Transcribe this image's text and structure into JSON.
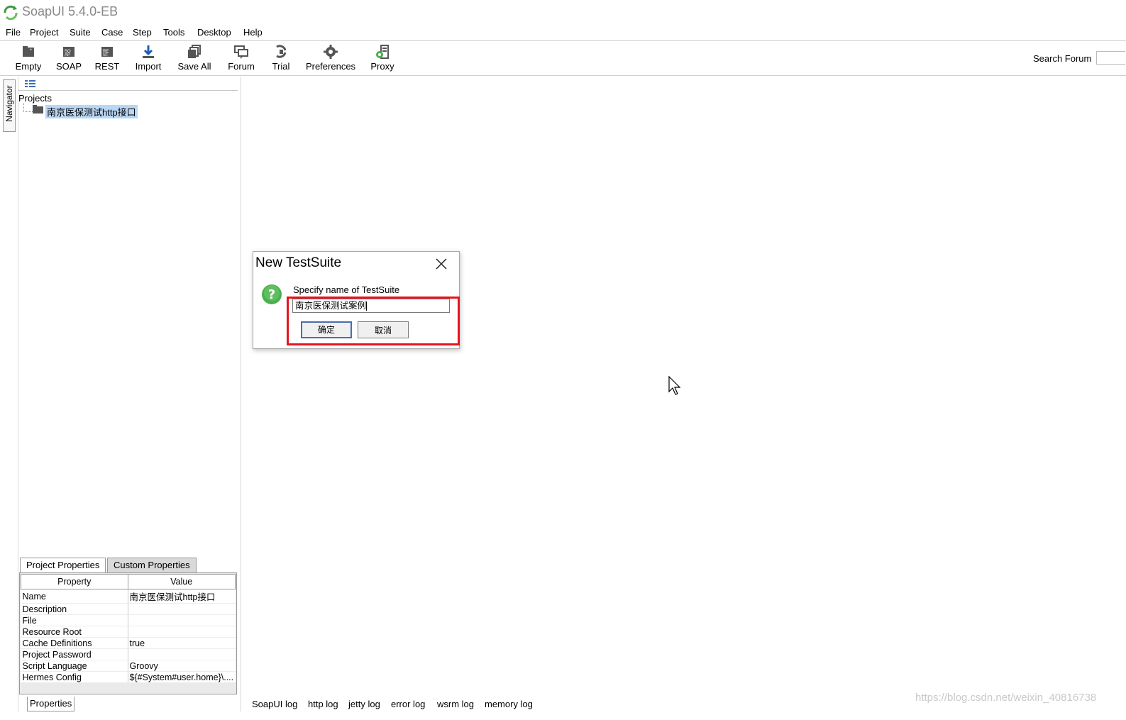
{
  "app": {
    "title": "SoapUI 5.4.0-EB"
  },
  "menu": [
    "File",
    "Project",
    "Suite",
    "Case",
    "Step",
    "Tools",
    "Desktop",
    "Help"
  ],
  "toolbar": {
    "buttons": [
      {
        "label": "Empty",
        "icon": "empty-project-icon"
      },
      {
        "label": "SOAP",
        "icon": "soap-project-icon"
      },
      {
        "label": "REST",
        "icon": "rest-project-icon"
      },
      {
        "label": "Import",
        "icon": "import-icon"
      },
      {
        "label": "Save All",
        "icon": "save-all-icon"
      },
      {
        "label": "Forum",
        "icon": "forum-icon"
      },
      {
        "label": "Trial",
        "icon": "trial-icon"
      },
      {
        "label": "Preferences",
        "icon": "gear-icon"
      },
      {
        "label": "Proxy",
        "icon": "proxy-icon"
      }
    ],
    "search_label": "Search Forum"
  },
  "navigator": {
    "tab_label": "Navigator",
    "root": "Projects",
    "project": "南京医保测试http接口"
  },
  "properties": {
    "tabs": [
      "Project Properties",
      "Custom Properties"
    ],
    "headers": [
      "Property",
      "Value"
    ],
    "rows": [
      [
        "Name",
        "南京医保测试http接口"
      ],
      [
        "Description",
        ""
      ],
      [
        "File",
        ""
      ],
      [
        "Resource Root",
        ""
      ],
      [
        "Cache Definitions",
        "true"
      ],
      [
        "Project Password",
        ""
      ],
      [
        "Script Language",
        "Groovy"
      ],
      [
        "Hermes Config",
        "${#System#user.home}\\...."
      ]
    ],
    "bottom_tab": "Properties"
  },
  "logs": [
    "SoapUI log",
    "http log",
    "jetty log",
    "error log",
    "wsrm log",
    "memory log"
  ],
  "dialog": {
    "title": "New TestSuite",
    "message": "Specify name of TestSuite",
    "input_value": "南京医保测试案例",
    "ok_label": "确定",
    "cancel_label": "取消"
  },
  "watermark": "https://blog.csdn.net/weixin_40816738",
  "colors": {
    "highlight": "#e8121b",
    "selection": "#b9d7f5",
    "icon_green": "#4caf50"
  }
}
